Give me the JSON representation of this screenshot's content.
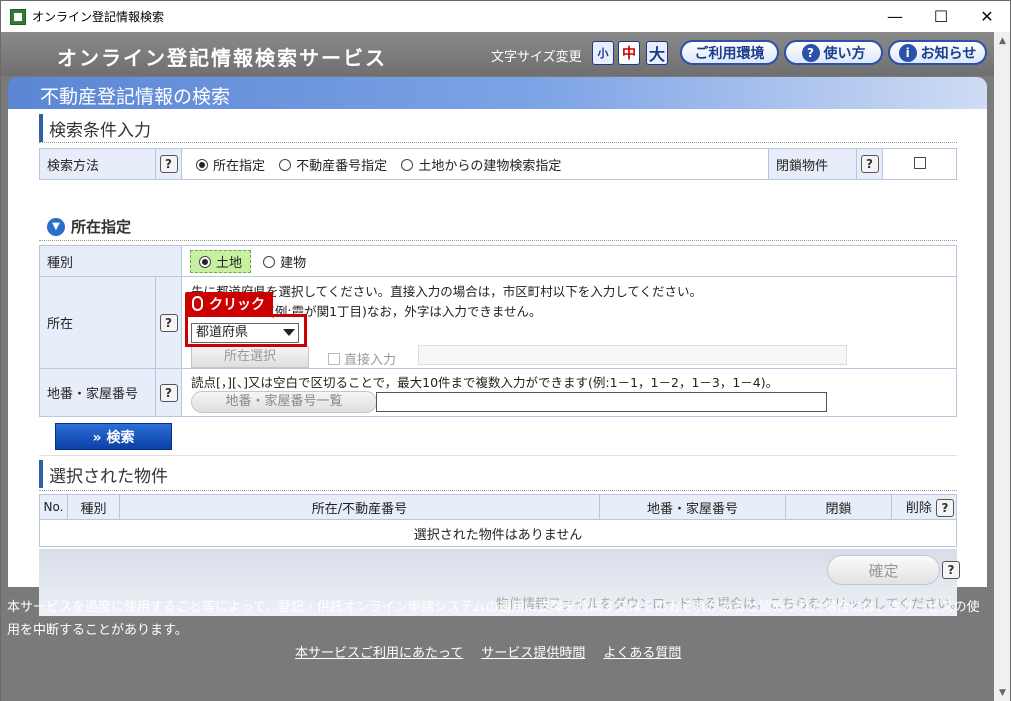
{
  "window": {
    "title": "オンライン登記情報検索",
    "ctrl_min": "—",
    "ctrl_max": "☐",
    "ctrl_close": "✕"
  },
  "header": {
    "logo": "オンライン登記情報検索サービス",
    "font_size_label": "文字サイズ変更",
    "fs_small": "小",
    "fs_medium": "中",
    "fs_large": "大",
    "env_button": "ご利用環境",
    "howto_button": "使い方",
    "notice_button": "お知らせ"
  },
  "banner": {
    "title": "不動産登記情報の検索"
  },
  "search_conditions": {
    "title": "検索条件入力",
    "method_label": "検索方法",
    "options": [
      "所在指定",
      "不動産番号指定",
      "土地からの建物検索指定"
    ],
    "closed_label": "閉鎖物件"
  },
  "location": {
    "title": "所在指定",
    "type_label": "種別",
    "type_options": [
      "土地",
      "建物"
    ],
    "loc_label": "所在",
    "hint1": "先に都道府県を選択してください。直接入力の場合は，市区町村以下を入力してください。",
    "hint2": "(例:霞が関1丁目)なお，外字は入力できません。",
    "hint2_prefix": "",
    "prefecture_select": "都道府県",
    "select_button": "所在選択",
    "direct_label": "直接入力",
    "lot_label": "地番・家屋番号",
    "lot_hint": "読点[，][、]又は空白で区切ることで，最大10件まで複数入力ができます(例:1－1，1－2，1－3，1－4)。",
    "lot_button": "地番・家屋番号一覧"
  },
  "annotation": {
    "click_label": "クリック"
  },
  "search_button": "» 検索",
  "selected": {
    "title": "選択された物件",
    "columns": [
      "No.",
      "種別",
      "所在/不動産番号",
      "地番・家屋番号",
      "閉鎖",
      "削除"
    ],
    "empty": "選択された物件はありません",
    "confirm": "確定",
    "download_hint": "物件情報ファイルをダウンロードする場合は，こちらをクリックしてください。"
  },
  "footer": {
    "notice": "本サービスを過度に使用すること等によって，登記・供託オンライン申請システムの運用に支障を及ぼす又はそのおそれがあると認められた場合には，本サービスの使用を中断することがあります。",
    "links": [
      "本サービスご利用にあたって",
      "サービス提供時間",
      "よくある質問"
    ]
  },
  "help_icon": "?"
}
